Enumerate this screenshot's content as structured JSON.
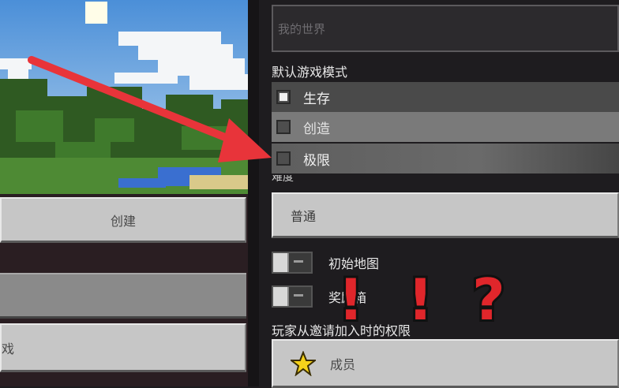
{
  "left": {
    "create_button": "创建",
    "partial_button": "戏"
  },
  "world_name": {
    "placeholder": "我的世界"
  },
  "game_mode": {
    "heading": "默认游戏模式",
    "options": [
      {
        "label": "生存",
        "checked": true
      },
      {
        "label": "创造",
        "checked": false
      },
      {
        "label": "极限",
        "checked": false
      }
    ]
  },
  "difficulty": {
    "heading": "难度",
    "value": "普通"
  },
  "toggles": {
    "starting_map": "初始地图",
    "bonus_chest": "奖励箱"
  },
  "permissions": {
    "heading": "玩家从邀请加入时的权限",
    "value": "成员"
  },
  "overlay": {
    "marks": [
      "!",
      "!",
      "?"
    ],
    "arrow_color": "#e8343a"
  },
  "colors": {
    "panel_bg": "#1e1c1f",
    "button_gray": "#c6c6c6",
    "row_selected": "#4a4a4a",
    "row_mid": "#7a7a7a"
  }
}
